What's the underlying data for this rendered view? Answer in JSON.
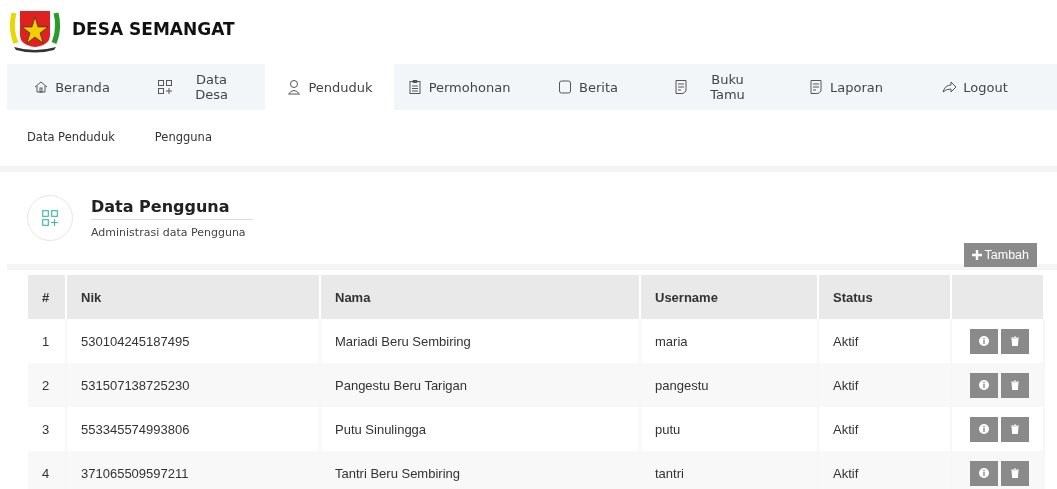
{
  "app": {
    "title": "DESA SEMANGAT"
  },
  "tabs": [
    {
      "label": "Beranda",
      "selected": false
    },
    {
      "label": "Data Desa",
      "selected": false
    },
    {
      "label": "Penduduk",
      "selected": true
    },
    {
      "label": "Permohonan",
      "selected": false
    },
    {
      "label": "Berita",
      "selected": false
    },
    {
      "label": "Buku Tamu",
      "selected": false
    },
    {
      "label": "Laporan",
      "selected": false
    },
    {
      "label": "Logout",
      "selected": false
    }
  ],
  "subnav": [
    "Data Penduduk",
    "Pengguna"
  ],
  "page_header": {
    "title": "Data Pengguna",
    "subtitle": "Administrasi data Pengguna"
  },
  "add_button": "Tambah",
  "table": {
    "columns": [
      "#",
      "Nik",
      "Nama",
      "Username",
      "Status"
    ],
    "rows": [
      [
        "1",
        "530104245187495",
        "Mariadi Beru Sembiring",
        "maria",
        "Aktif"
      ],
      [
        "2",
        "531507138725230",
        "Pangestu Beru Tarigan",
        "pangestu",
        "Aktif"
      ],
      [
        "3",
        "553345574993806",
        "Putu Sinulingga",
        "putu",
        "Aktif"
      ],
      [
        "4",
        "371065509597211",
        "Tantri Beru Sembiring",
        "tantri",
        "Aktif"
      ]
    ]
  }
}
